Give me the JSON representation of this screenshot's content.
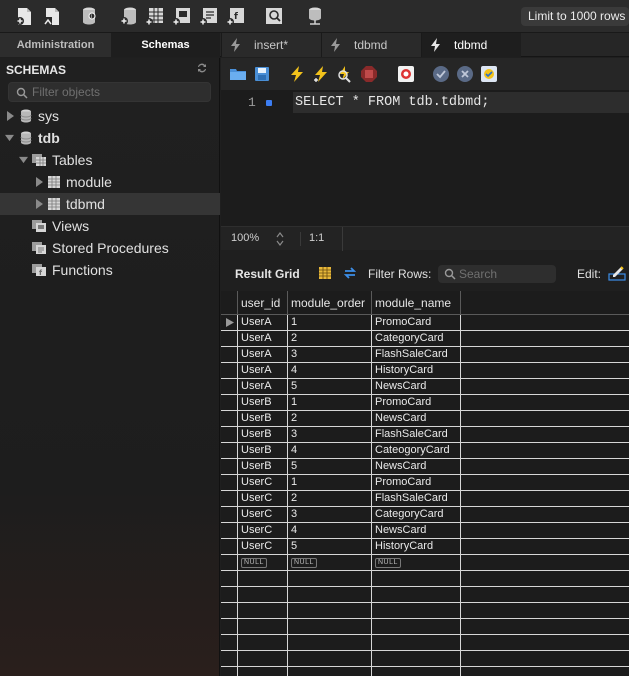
{
  "toolbar": {
    "buttons": [
      {
        "name": "new-sql-tab-icon"
      },
      {
        "name": "open-sql-file-icon"
      },
      {
        "name": "inspector-icon"
      },
      {
        "name": "create-schema-icon"
      },
      {
        "name": "create-table-icon"
      },
      {
        "name": "create-view-icon"
      },
      {
        "name": "create-procedure-icon"
      },
      {
        "name": "create-function-icon"
      },
      {
        "name": "search-table-data-icon"
      },
      {
        "name": "reconnect-icon"
      }
    ]
  },
  "sidebar_tabs": {
    "administration": "Administration",
    "schemas": "Schemas"
  },
  "query_tabs": [
    {
      "label": "insert*",
      "active": false
    },
    {
      "label": "tdbmd",
      "active": false
    },
    {
      "label": "tdbmd",
      "active": true
    }
  ],
  "sidebar": {
    "title": "SCHEMAS",
    "filter_placeholder": "Filter objects",
    "tree": {
      "sys": "sys",
      "tdb": "tdb",
      "tables": "Tables",
      "module": "module",
      "tdbmd": "tdbmd",
      "views": "Views",
      "stored_procedures": "Stored Procedures",
      "functions": "Functions"
    }
  },
  "editor": {
    "limit_label": "Limit to 1000 rows",
    "line_number": "1",
    "sql": "SELECT * FROM tdb.tdbmd;",
    "zoom": "100%",
    "cursor_position": "1:1"
  },
  "result": {
    "grid_label": "Result Grid",
    "filter_rows_label": "Filter Rows:",
    "search_placeholder": "Search",
    "edit_label": "Edit:",
    "columns": [
      "user_id",
      "module_order",
      "module_name"
    ],
    "rows": [
      [
        "UserA",
        "1",
        "PromoCard"
      ],
      [
        "UserA",
        "2",
        "CategoryCard"
      ],
      [
        "UserA",
        "3",
        "FlashSaleCard"
      ],
      [
        "UserA",
        "4",
        "HistoryCard"
      ],
      [
        "UserA",
        "5",
        "NewsCard"
      ],
      [
        "UserB",
        "1",
        "PromoCard"
      ],
      [
        "UserB",
        "2",
        "NewsCard"
      ],
      [
        "UserB",
        "3",
        "FlashSaleCard"
      ],
      [
        "UserB",
        "4",
        "CateogoryCard"
      ],
      [
        "UserB",
        "5",
        "NewsCard"
      ],
      [
        "UserC",
        "1",
        "PromoCard"
      ],
      [
        "UserC",
        "2",
        "FlashSaleCard"
      ],
      [
        "UserC",
        "3",
        "CategoryCard"
      ],
      [
        "UserC",
        "4",
        "NewsCard"
      ],
      [
        "UserC",
        "5",
        "HistoryCard"
      ]
    ],
    "null_label": "NULL"
  }
}
